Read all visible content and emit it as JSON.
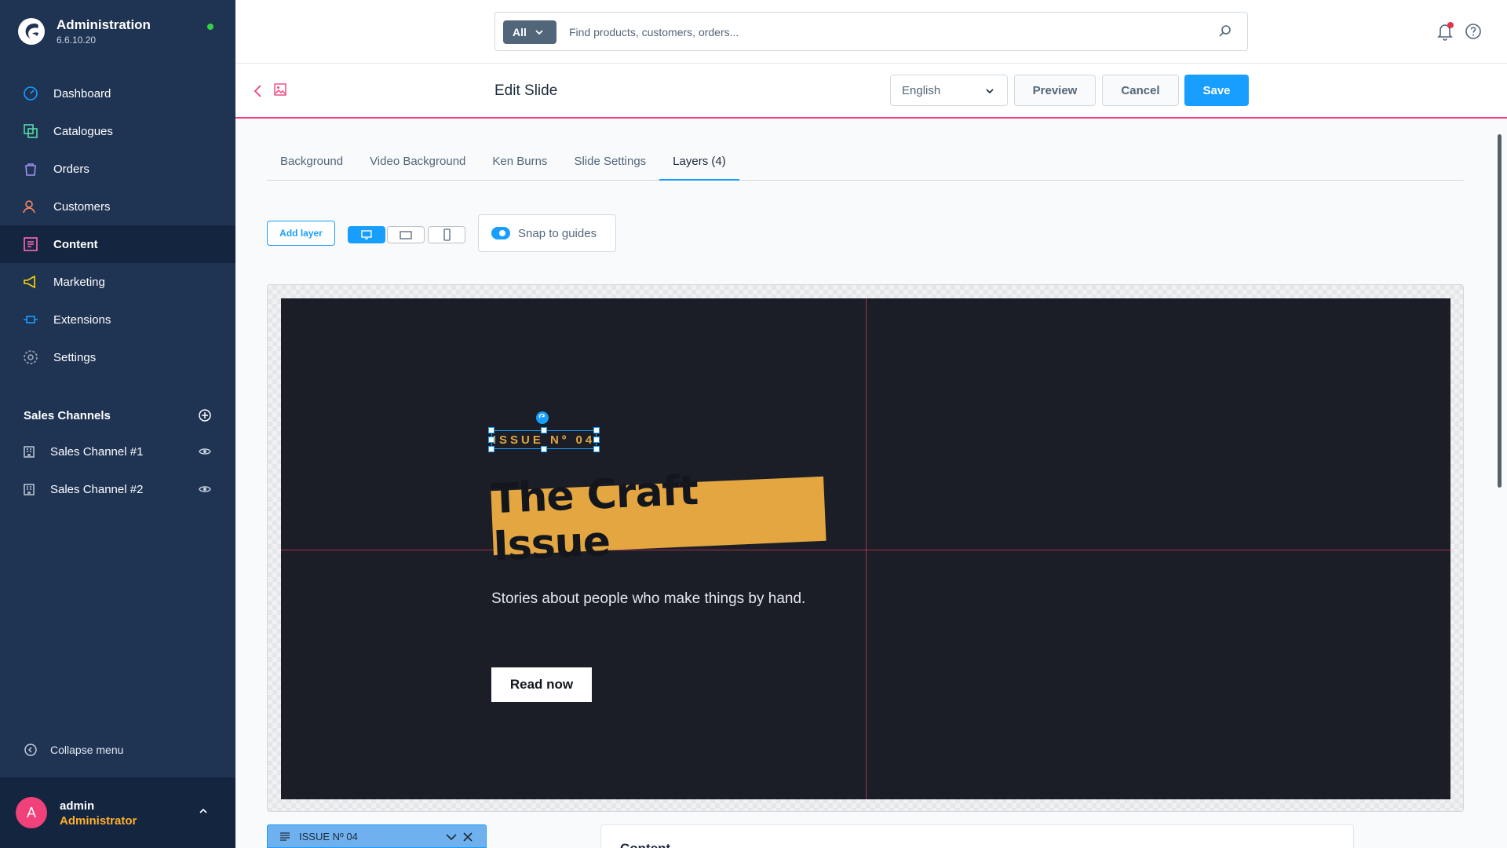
{
  "brand": {
    "title": "Administration",
    "version": "6.6.10.20"
  },
  "nav": [
    {
      "label": "Dashboard",
      "icon": "dashboard-icon",
      "color": "#189eff"
    },
    {
      "label": "Catalogues",
      "icon": "catalogue-icon",
      "color": "#57d9a3"
    },
    {
      "label": "Orders",
      "icon": "orders-icon",
      "color": "#a092f0"
    },
    {
      "label": "Customers",
      "icon": "customers-icon",
      "color": "#f88962"
    },
    {
      "label": "Content",
      "icon": "content-icon",
      "color": "#ff68b4"
    },
    {
      "label": "Marketing",
      "icon": "marketing-icon",
      "color": "#ffd700"
    },
    {
      "label": "Extensions",
      "icon": "extensions-icon",
      "color": "#189eff"
    },
    {
      "label": "Settings",
      "icon": "settings-icon",
      "color": "#9aa8b5"
    }
  ],
  "sales_channels": {
    "heading": "Sales Channels",
    "items": [
      {
        "label": "Sales Channel #1"
      },
      {
        "label": "Sales Channel #2"
      }
    ]
  },
  "collapse_label": "Collapse menu",
  "user": {
    "initial": "A",
    "name": "admin",
    "role": "Administrator"
  },
  "search": {
    "type": "All",
    "placeholder": "Find products, customers, orders..."
  },
  "smartbar": {
    "title": "Edit Slide",
    "language": "English",
    "preview": "Preview",
    "cancel": "Cancel",
    "save": "Save"
  },
  "tabs": [
    {
      "label": "Background"
    },
    {
      "label": "Video Background"
    },
    {
      "label": "Ken Burns"
    },
    {
      "label": "Slide Settings"
    },
    {
      "label": "Layers (4)",
      "active": true
    }
  ],
  "toolbar": {
    "add_layer": "Add layer",
    "snap": "Snap to guides",
    "snap_on": true
  },
  "slide": {
    "issue": "ISSUE Nº 04",
    "title": "The Craft Issue",
    "subtitle": "Stories about people who make things by hand.",
    "cta": "Read now"
  },
  "layer_strip": {
    "label": "ISSUE Nº 04"
  },
  "content_card": {
    "title": "Content"
  },
  "colors": {
    "sidebar": "#1f3353",
    "accent": "#189eff",
    "brand_pink": "#f0417b",
    "gold": "#e3a641"
  }
}
